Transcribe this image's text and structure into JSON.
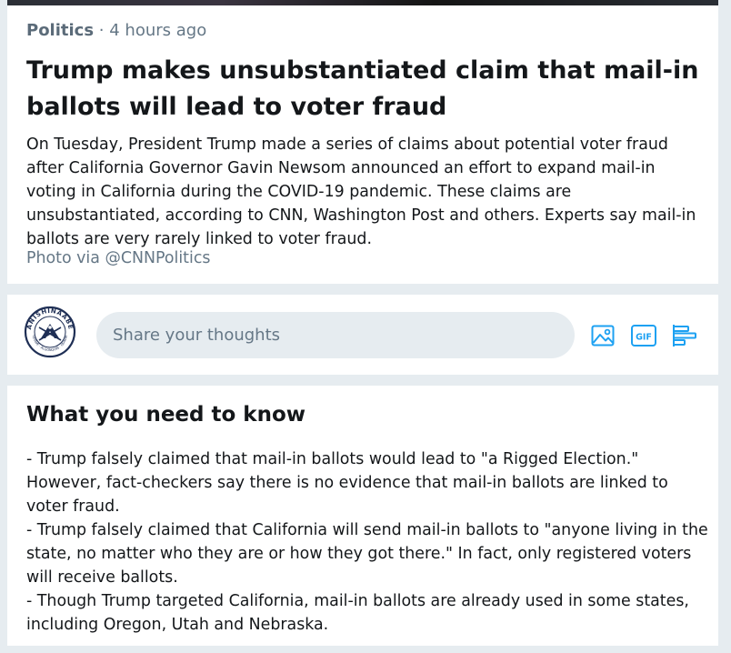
{
  "story": {
    "category": "Politics",
    "separator": " · ",
    "time": "4 hours ago",
    "headline": "Trump makes unsubstantiated claim that mail-in ballots will lead to voter fraud",
    "summary": "On Tuesday, President Trump made a series of claims about potential voter fraud after California Governor Gavin Newsom announced an effort to expand mail-in voting in California during the COVID-19 pandemic. These claims are unsubstantiated, according to CNN, Washington Post and others. Experts say mail-in ballots are very rarely linked to voter fraud.",
    "photo_credit": "Photo via @CNNPolitics"
  },
  "compose": {
    "avatar_icon": "anishinaabe-seal-avatar",
    "avatar_top_text": "ANISHINAABE",
    "avatar_bottom_text": "OJIBWE · ALGONQUIN · ODAWA",
    "placeholder": "Share your thoughts",
    "tools": [
      {
        "name": "image-icon"
      },
      {
        "name": "gif-icon",
        "label": "GIF"
      },
      {
        "name": "poll-icon"
      }
    ],
    "accent_color": "#1da1f2"
  },
  "know": {
    "title": "What you need to know",
    "items": [
      "- Trump falsely claimed that mail-in ballots would lead to \"a Rigged Election.\" However, fact-checkers say there is no evidence that mail-in ballots are linked to voter fraud.",
      "- Trump falsely claimed that California will send mail-in ballots to \"anyone living in the state, no matter who they are or how they got there.\" In fact, only registered voters will receive ballots.",
      "- Though Trump targeted California, mail-in ballots are already used in some states, including Oregon, Utah and Nebraska."
    ]
  }
}
